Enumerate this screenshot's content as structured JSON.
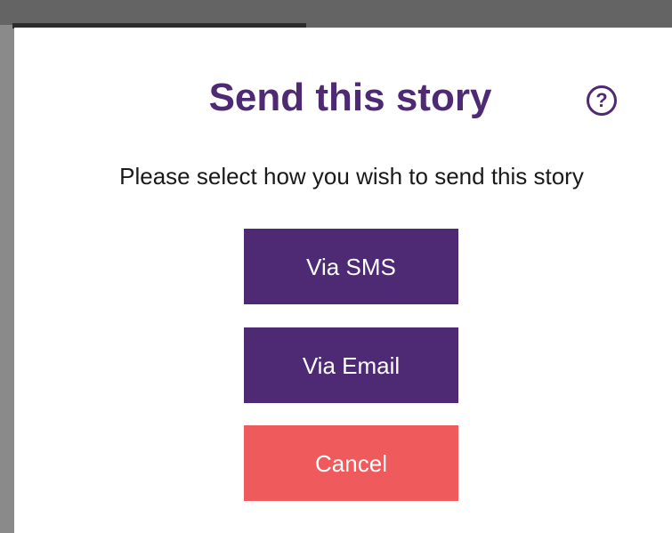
{
  "dialog": {
    "title": "Send this story",
    "help_icon_glyph": "?",
    "subtitle": "Please select how you wish to send this story",
    "buttons": {
      "sms": "Via SMS",
      "email": "Via Email",
      "cancel": "Cancel"
    }
  },
  "colors": {
    "primary": "#4f2a74",
    "cancel": "#ef5a5d",
    "overlay": "#646464"
  },
  "icons": {
    "help": "help-circle-icon"
  }
}
